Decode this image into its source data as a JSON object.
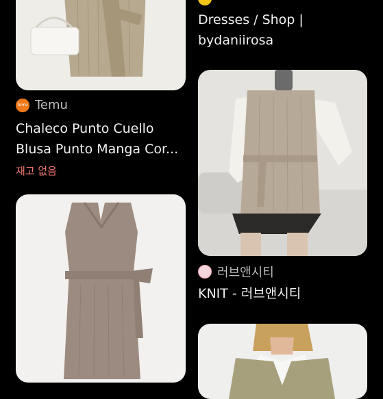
{
  "left_column": {
    "card_top": {
      "image_alt": "sweater-dress-with-belt"
    },
    "card_temu": {
      "source": "Temu",
      "source_icon_text": "Temu",
      "title_line1": "Chaleco Punto Cuello",
      "title_line2": "Blusa Punto Manga Cor...",
      "stock_status": "재고 없음",
      "colors": {
        "source_icon": "#f07a1a",
        "stock_status": "#f07a72"
      }
    },
    "card_bottom": {
      "image_alt": "belted-knit-vest-dress"
    }
  },
  "right_column": {
    "card_top": {
      "title_line1": "Dresses / Shop |",
      "title_line2": "bydaniirosa",
      "colors": {
        "source_icon": "#f5c518"
      }
    },
    "card_knit": {
      "source": "러브앤시티",
      "title": "KNIT - 러브앤시티",
      "colors": {
        "source_icon": "#f2a7b5"
      }
    },
    "card_bottom": {
      "image_alt": "knit-vest-over-shirt"
    }
  }
}
